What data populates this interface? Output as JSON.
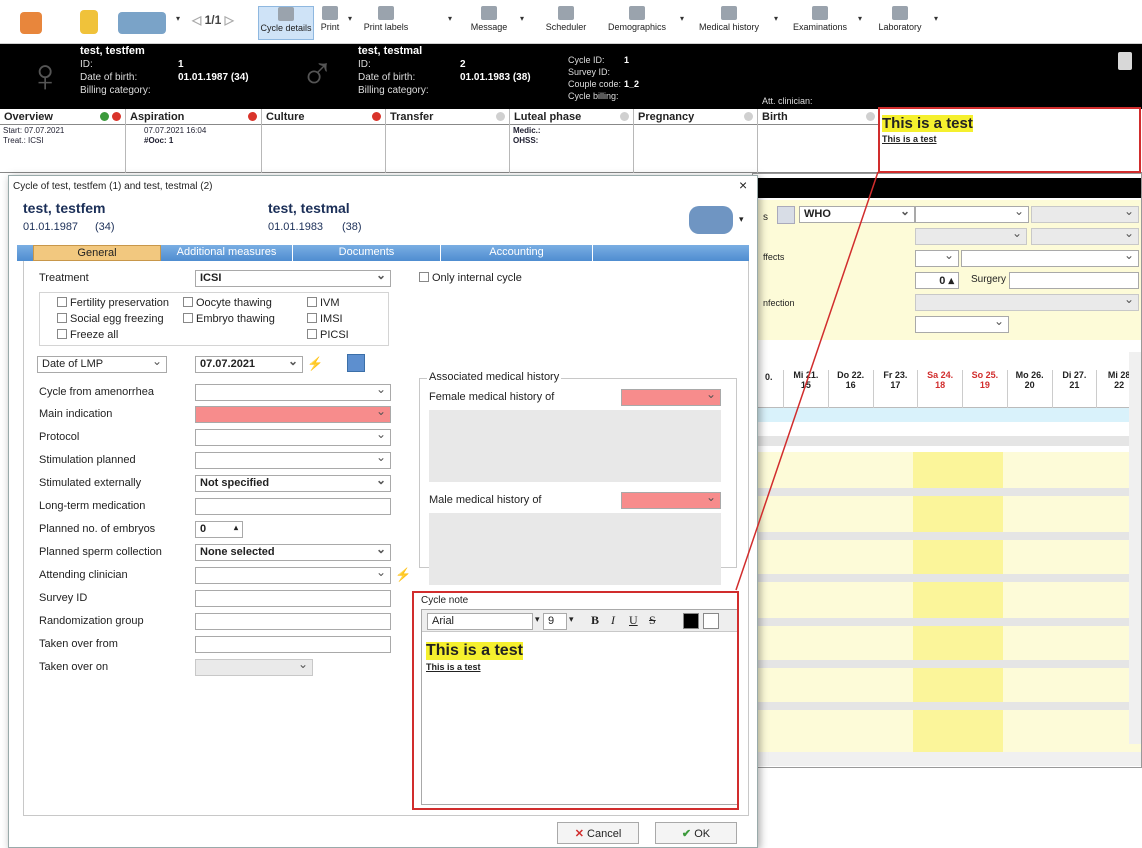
{
  "toolbar": {
    "page_counter": "1/1",
    "buttons": [
      "Cycle details",
      "Print",
      "Print labels",
      "Message",
      "Scheduler",
      "Demographics",
      "Medical history",
      "Examinations",
      "Laboratory"
    ]
  },
  "header": {
    "female": {
      "name": "test, testfem",
      "id_label": "ID:",
      "id": "1",
      "dob_label": "Date of birth:",
      "dob": "01.01.1987  (34)",
      "billing_label": "Billing category:"
    },
    "male": {
      "name": "test, testmal",
      "id_label": "ID:",
      "id": "2",
      "dob_label": "Date of birth:",
      "dob": "01.01.1983  (38)",
      "billing_label": "Billing category:"
    },
    "cycle_id_label": "Cycle ID:",
    "cycle_id": "1",
    "survey_id_label": "Survey ID:",
    "couple_code_label": "Couple code:",
    "couple_code": "1_2",
    "cycle_billing_label": "Cycle billing:",
    "att_clinician_label": "Att. clinician:"
  },
  "phases": [
    {
      "title": "Overview",
      "lines": [
        "Start: 07.07.2021",
        "Treat.: ICSI"
      ]
    },
    {
      "title": "Aspiration",
      "lines": [
        "07.07.2021 16:04",
        "#Ooc: 1"
      ]
    },
    {
      "title": "Culture",
      "lines": []
    },
    {
      "title": "Transfer",
      "lines": []
    },
    {
      "title": "Luteal phase",
      "lines": [
        "Medic.:",
        "OHSS:"
      ]
    },
    {
      "title": "Pregnancy",
      "lines": []
    },
    {
      "title": "Birth",
      "lines": []
    }
  ],
  "note_preview": {
    "big": "This is a test",
    "small": "This is a test"
  },
  "right_panel": {
    "who": "WHO",
    "effects_label": "ffects",
    "infection_label": "nfection",
    "surgery_label": "Surgery",
    "count_value": "0",
    "days": [
      {
        "d": "Mi 21.",
        "n": "15",
        "weekend": false
      },
      {
        "d": "Do 22.",
        "n": "16",
        "weekend": false
      },
      {
        "d": "Fr 23.",
        "n": "17",
        "weekend": false
      },
      {
        "d": "Sa 24.",
        "n": "18",
        "weekend": true
      },
      {
        "d": "So 25.",
        "n": "19",
        "weekend": true
      },
      {
        "d": "Mo 26.",
        "n": "20",
        "weekend": false
      },
      {
        "d": "Di 27.",
        "n": "21",
        "weekend": false
      },
      {
        "d": "Mi 28",
        "n": "22",
        "weekend": false
      }
    ]
  },
  "dialog": {
    "title": "Cycle of test, testfem (1) and test, testmal (2)",
    "female_name": "test, testfem",
    "female_dob": "01.01.1987",
    "female_age": "(34)",
    "male_name": "test, testmal",
    "male_dob": "01.01.1983",
    "male_age": "(38)",
    "tabs": [
      "General",
      "Additional measures",
      "Documents",
      "Accounting"
    ],
    "treatment_label": "Treatment",
    "treatment_value": "ICSI",
    "only_internal": "Only internal cycle",
    "checkboxes": [
      "Fertility preservation",
      "Oocyte thawing",
      "IVM",
      "Social egg freezing",
      "Embryo thawing",
      "IMSI",
      "Freeze all",
      "PICSI"
    ],
    "date_type": "Date of LMP",
    "date_value": "07.07.2021",
    "fields": [
      {
        "label": "Cycle from amenorrhea",
        "value": ""
      },
      {
        "label": "Main indication",
        "value": ""
      },
      {
        "label": "Protocol",
        "value": ""
      },
      {
        "label": "Stimulation planned",
        "value": ""
      },
      {
        "label": "Stimulated externally",
        "value": "Not specified"
      },
      {
        "label": "Long-term medication",
        "value": ""
      },
      {
        "label": "Planned no. of embryos",
        "value": "0"
      },
      {
        "label": "Planned sperm collection",
        "value": "None selected"
      },
      {
        "label": "Attending clinician",
        "value": ""
      },
      {
        "label": "Survey ID",
        "value": ""
      },
      {
        "label": "Randomization group",
        "value": ""
      },
      {
        "label": "Taken over from",
        "value": ""
      },
      {
        "label": "Taken over on",
        "value": ""
      }
    ],
    "assoc_title": "Associated medical history",
    "female_hist_label": "Female medical history of",
    "male_hist_label": "Male medical history of",
    "cycle_note_label": "Cycle note",
    "font_name": "Arial",
    "font_size": "9",
    "fmt": {
      "b": "B",
      "i": "I",
      "u": "U",
      "s": "S"
    },
    "note_big": "This is a test",
    "note_small": "This is a test",
    "cancel": "Cancel",
    "ok": "OK"
  },
  "colors": {
    "accent": "#4a90d9",
    "required": "#f78c8c",
    "highlight": "#f5f02e",
    "redbox": "#d12d2d"
  }
}
